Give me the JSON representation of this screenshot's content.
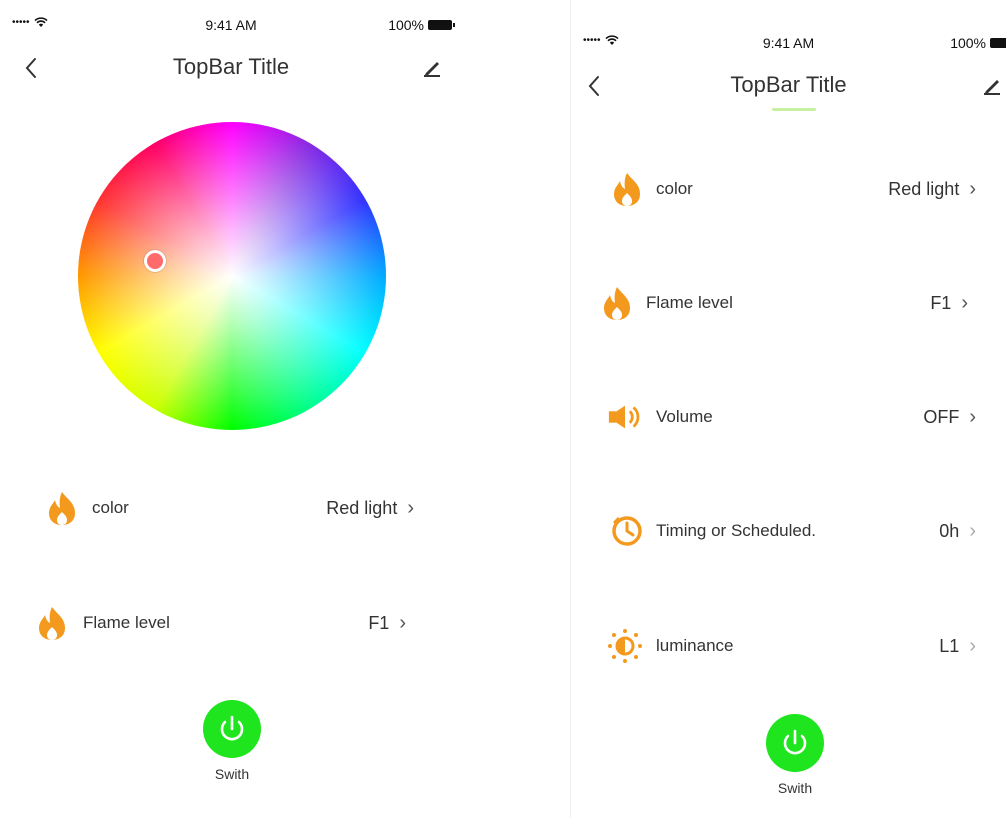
{
  "left": {
    "status": {
      "signal": "•••••",
      "time": "9:41 AM",
      "battery": "100%"
    },
    "topbar": {
      "title": "TopBar Title"
    },
    "rows": [
      {
        "label": "color",
        "value": "Red light",
        "chevron": "›"
      },
      {
        "label": "Flame level",
        "value": "F1",
        "chevron": "›"
      }
    ],
    "power": {
      "caption": "Swith"
    }
  },
  "right": {
    "status": {
      "signal": "•••••",
      "time": "9:41 AM",
      "battery": "100%"
    },
    "topbar": {
      "title": "TopBar Title"
    },
    "rows": [
      {
        "label": "color",
        "value": "Red light",
        "chevron": "›",
        "icon": "flame-icon"
      },
      {
        "label": "Flame level",
        "value": "F1",
        "chevron": "›",
        "icon": "flame-icon"
      },
      {
        "label": "Volume",
        "value": "OFF",
        "chevron": "›",
        "icon": "speaker-icon"
      },
      {
        "label": "Timing or Scheduled.",
        "value": "0h",
        "chevron": "›",
        "icon": "clock-icon"
      },
      {
        "label": "luminance",
        "value": "L1",
        "chevron": "›",
        "icon": "sun-icon"
      }
    ],
    "power": {
      "caption": "Swith"
    }
  },
  "colors": {
    "accent": "#f39a1e",
    "power": "#1fe51f",
    "picker": "#ff6a6a"
  }
}
